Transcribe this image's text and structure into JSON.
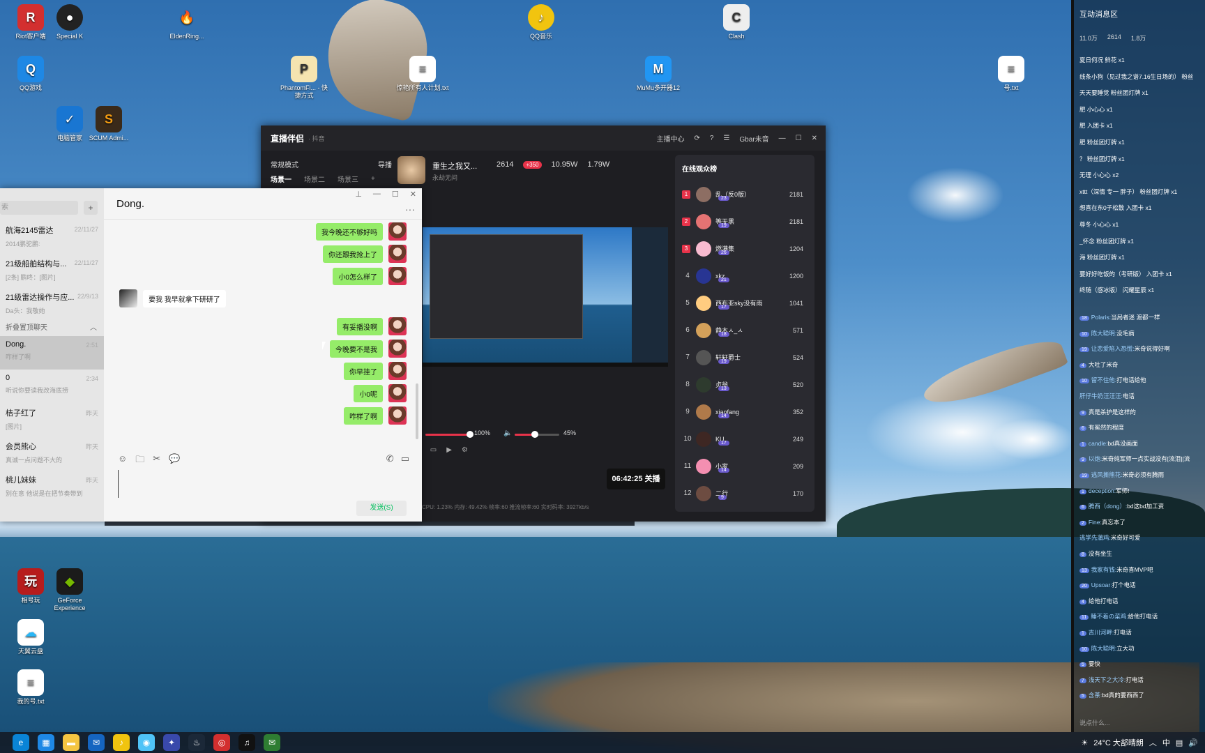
{
  "desktop_icons": [
    {
      "label": "Riot客户端",
      "color": "#d32f2f",
      "glyph": "R"
    },
    {
      "label": "Special K",
      "color": "#222",
      "glyph": "●"
    },
    {
      "label": "EldenRing...",
      "color": "#e57373",
      "glyph": "🔥"
    },
    {
      "label": "QQ音乐",
      "color": "#f1c40f",
      "glyph": "♪"
    },
    {
      "label": "Clash",
      "color": "#eee",
      "glyph": "C"
    },
    {
      "label": "QQ游戏",
      "color": "#1e88e5",
      "glyph": "Q"
    },
    {
      "label": "PhantomFi... - 快捷方式",
      "color": "#f5e4b0",
      "glyph": "P"
    },
    {
      "label": "惊艳所有人计划.txt",
      "color": "#fff",
      "glyph": "≡"
    },
    {
      "label": "MuMu多开器12",
      "color": "#2196f3",
      "glyph": "M"
    },
    {
      "label": "号.txt",
      "color": "#fff",
      "glyph": "≡"
    },
    {
      "label": "电脑管家",
      "color": "#1976d2",
      "glyph": "✓"
    },
    {
      "label": "SCUM Admi...",
      "color": "#3a2a1a",
      "glyph": "S"
    },
    {
      "label": "相号玩",
      "color": "#b71c1c",
      "glyph": "玩"
    },
    {
      "label": "GeForce Experience",
      "color": "#76b900",
      "glyph": "◆"
    },
    {
      "label": "天翼云盘",
      "color": "#29b6f6",
      "glyph": "☁"
    },
    {
      "label": "我的号.txt",
      "color": "#fff",
      "glyph": "≡"
    }
  ],
  "chat": {
    "search_placeholder": "索",
    "title": "Dong.",
    "conversations": [
      {
        "name": "航海2145雷达",
        "preview": "2014鹏驼鹏:",
        "time": "22/11/27"
      },
      {
        "name": "21级船舶结构与...",
        "preview": "[2条] 鹏咚：[图片]",
        "time": "22/11/27"
      },
      {
        "name": "21级雷达操作与应...",
        "preview": "Da头：我敬她",
        "time": "22/9/13"
      }
    ],
    "fold_label": "折叠置顶聊天",
    "conversations2": [
      {
        "name": "Dong.",
        "preview": "咋样了啊",
        "time": "2:51"
      },
      {
        "name": "0",
        "preview": "听说你要读我改海底捞",
        "time": "2:34"
      },
      {
        "name": "桔子红了",
        "preview": "[图片]",
        "time": "昨天"
      },
      {
        "name": "会员熊心",
        "preview": "真诚一点问题不大的",
        "time": "昨天"
      },
      {
        "name": "桃儿妹妹",
        "preview": "别在意 他说是在把节奏带到",
        "time": "昨天"
      }
    ],
    "messages": [
      {
        "side": "right",
        "text": "我今晚还不够好吗"
      },
      {
        "side": "right",
        "text": "你还跟我抢上了"
      },
      {
        "side": "right",
        "text": "小0怎么样了"
      },
      {
        "side": "left",
        "text": "要我 我早就拿下研研了"
      },
      {
        "side": "right",
        "text": "有妥播没啊"
      },
      {
        "side": "right",
        "text": "今晚要不是我"
      },
      {
        "side": "right",
        "text": "你早挂了"
      },
      {
        "side": "right",
        "text": "小0呢"
      },
      {
        "side": "right",
        "text": "咋样了啊"
      }
    ],
    "send_label": "发送(S)"
  },
  "live": {
    "app_name": "直播伴侣",
    "platform": "· 抖音",
    "top_links": [
      "主播中心"
    ],
    "user": "Gbar未音",
    "mode": "常规模式",
    "guide": "导播",
    "scenes": [
      "场景一",
      "场景二",
      "场景三"
    ],
    "streamer_name": "重生之我又...",
    "streamer_sub": "永劫无间",
    "viewers": "2614",
    "badge": "+350",
    "likes": "10.95W",
    "gifts": "1.79W",
    "mic_volume": "100%",
    "speaker_volume": "45%",
    "mic_level": 1.0,
    "speaker_level": 0.45,
    "timer": "06:42:25 关播",
    "status": "CPU: 1.23%   内存: 49.42%   帧率:60   推流帧率:60   实时码率: 3927kb/s",
    "audience_title": "在线观众榜",
    "audience": [
      {
        "rank": "1",
        "name": "乱（反0版）",
        "score": "2181",
        "lv": "23",
        "color": "#8d6e63"
      },
      {
        "rank": "2",
        "name": "等天黑",
        "score": "2181",
        "lv": "19",
        "color": "#e57373"
      },
      {
        "rank": "3",
        "name": "燃满集",
        "score": "1204",
        "lv": "26",
        "color": "#f8bbd0"
      },
      {
        "rank": "4",
        "name": "xkz",
        "score": "1200",
        "lv": "21",
        "color": "#283593"
      },
      {
        "rank": "5",
        "name": "西布亚sky没有雨",
        "score": "1041",
        "lv": "17",
        "color": "#ffcc80"
      },
      {
        "rank": "6",
        "name": "静木ㅅ_ㅅ",
        "score": "571",
        "lv": "18",
        "color": "#d4a15a"
      },
      {
        "rank": "7",
        "name": "轩轩爵士",
        "score": "524",
        "lv": "19",
        "color": "#555"
      },
      {
        "rank": "8",
        "name": "贞翁",
        "score": "520",
        "lv": "13",
        "color": "#2e3b2e"
      },
      {
        "rank": "9",
        "name": "xiaofang",
        "score": "352",
        "lv": "14",
        "color": "#b07a4a"
      },
      {
        "rank": "10",
        "name": "KU",
        "score": "249",
        "lv": "17",
        "color": "#3e2723"
      },
      {
        "rank": "11",
        "name": "小家",
        "score": "209",
        "lv": "14",
        "color": "#f48fb1"
      },
      {
        "rank": "12",
        "name": "二行",
        "score": "170",
        "lv": "9",
        "color": "#6d4c41"
      }
    ]
  },
  "right_panel": {
    "title": "互动消息区",
    "likes": "11.0万",
    "viewers": "2614",
    "gifts": "1.8万",
    "gifts_list": [
      "夏日何况 鲜花 x1",
      "线条小狗（见过我之谱7.16生日场的） 粉丝",
      "天天要睡觉 粉丝团灯牌 x1",
      "肥 小心心 x1",
      "肥 入团卡 x1",
      "肥 粉丝团灯牌 x1",
      "？ 粉丝团灯牌 x1",
      "无理 小心心 x2",
      "xttt（深情 专一 胖子） 粉丝团灯牌 x1",
      "想喜在东0子松散 入团卡 x1",
      "尊冬 小心心 x1",
      "_怀念 粉丝团灯牌 x1",
      "海 粉丝团灯牌 x1",
      "要好好吃饭的（考研版） 入团卡 x1",
      "终随（感冰版） 闪耀星辰 x1"
    ],
    "comments": [
      {
        "lv": "18",
        "user": "Polaris:",
        "text": "当局者迷 渡都一样"
      },
      {
        "lv": "10",
        "user": "陈大聪明:",
        "text": "没毛病"
      },
      {
        "lv": "19",
        "user": "让恋爱陷入恐慌:",
        "text": "米奇说得好啊"
      },
      {
        "lv": "4",
        "user": "",
        "text": "大吐了米奇"
      },
      {
        "lv": "10",
        "user": "留不住他:",
        "text": "打电话给他"
      },
      {
        "lv": "",
        "user": "肝仔牛奶汪汪汪:",
        "text": "电话"
      },
      {
        "lv": "9",
        "user": "",
        "text": "真是杀护是这样的"
      },
      {
        "lv": "6",
        "user": "",
        "text": "有冕然的程度"
      },
      {
        "lv": "1",
        "user": "candle:",
        "text": "bd真没画面"
      },
      {
        "lv": "9",
        "user": "以炮:",
        "text": "米奇纯军师一点实战没有[流泪][流"
      },
      {
        "lv": "19",
        "user": "逃风撕熊花:",
        "text": "米奇必须有腾雨"
      },
      {
        "lv": "1",
        "user": "deception:",
        "text": "军师!"
      },
      {
        "lv": "6",
        "user": "腾西（dong）:",
        "text": "bd这bd加工资"
      },
      {
        "lv": "2",
        "user": "Fine:",
        "text": "真忘本了"
      },
      {
        "lv": "",
        "user": "逃学先蒲鸡:",
        "text": "米奇好可爱"
      },
      {
        "lv": "8",
        "user": "",
        "text": "没有坐生"
      },
      {
        "lv": "13",
        "user": "我家有钱:",
        "text": "米奇喜MVP吧"
      },
      {
        "lv": "20",
        "user": "Upsoar:",
        "text": "打个电话"
      },
      {
        "lv": "4",
        "user": "",
        "text": "给他打电话"
      },
      {
        "lv": "11",
        "user": "睡不着の菜鸡:",
        "text": "给他打电话"
      },
      {
        "lv": "1",
        "user": "吉川河畔:",
        "text": "打电话"
      },
      {
        "lv": "10",
        "user": "陈大聪明:",
        "text": "立大功"
      },
      {
        "lv": "5",
        "user": "",
        "text": "要快"
      },
      {
        "lv": "7",
        "user": "浅天下之大冷:",
        "text": "打电话"
      },
      {
        "lv": "5",
        "user": "含茶:",
        "text": "bd真的要西西了"
      }
    ],
    "input_placeholder": "说点什么..."
  },
  "taskbar": {
    "weather": "24°C 大部晴朗",
    "ime": "中"
  }
}
